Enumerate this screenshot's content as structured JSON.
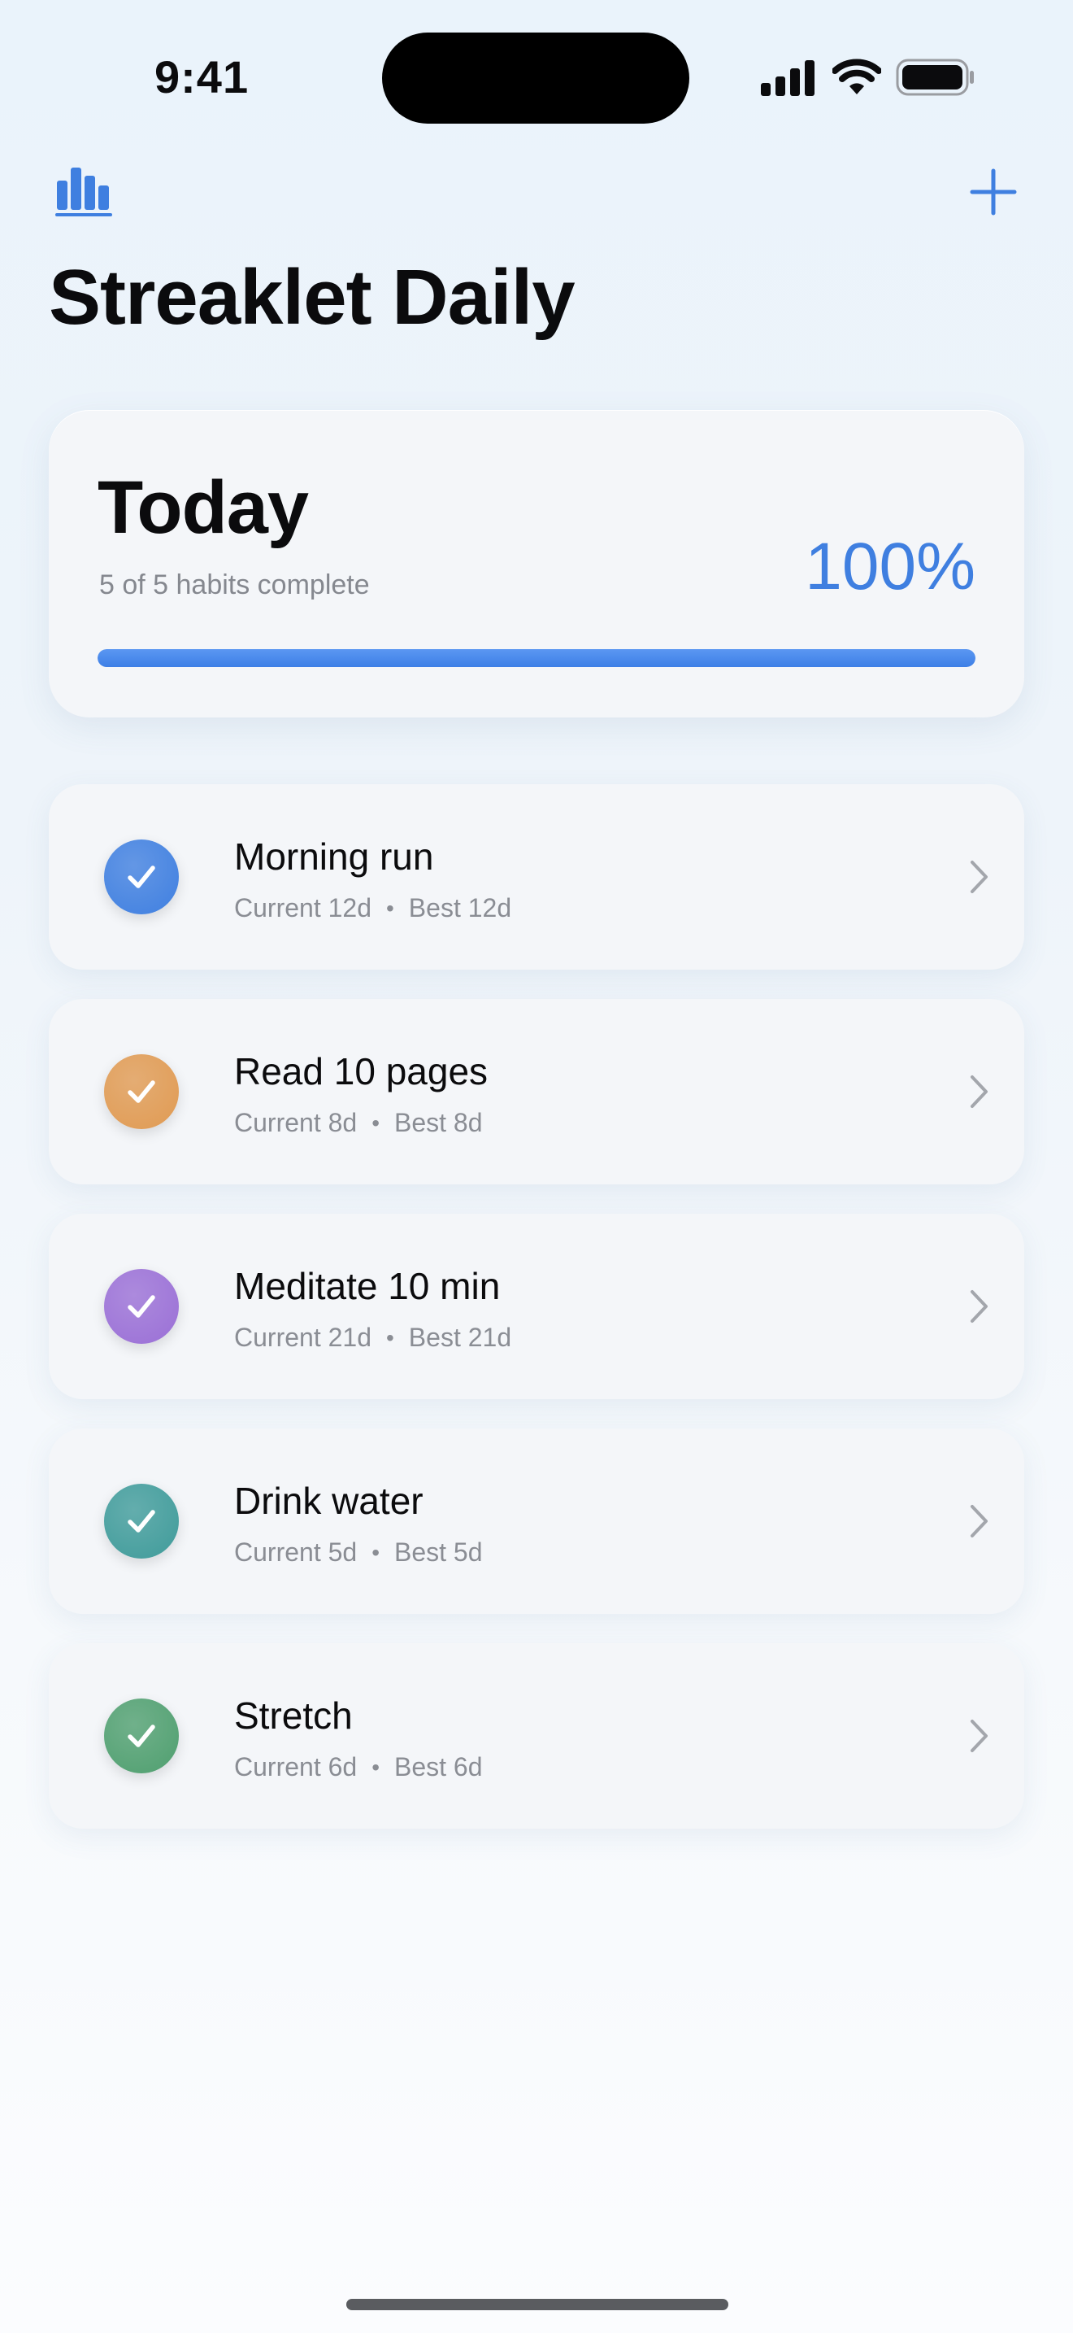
{
  "status_bar": {
    "time": "9:41"
  },
  "nav": {
    "stats_icon": "bar-chart-icon",
    "add_icon": "plus-icon",
    "accent": "#3f7fe0"
  },
  "app": {
    "title": "Streaklet Daily"
  },
  "summary": {
    "title": "Today",
    "subtitle": "5 of 5 habits complete",
    "percent_label": "100%",
    "progress": 1.0
  },
  "habits": [
    {
      "name": "Morning run",
      "current": "Current 12d",
      "best": "Best 12d",
      "color": "#3f7fe0",
      "done": true
    },
    {
      "name": "Read 10 pages",
      "current": "Current 8d",
      "best": "Best 8d",
      "color": "#e09a52",
      "done": true
    },
    {
      "name": "Meditate 10 min",
      "current": "Current 21d",
      "best": "Best 21d",
      "color": "#9a6fd6",
      "done": true
    },
    {
      "name": "Drink water",
      "current": "Current 5d",
      "best": "Best 5d",
      "color": "#3f9b9a",
      "done": true
    },
    {
      "name": "Stretch",
      "current": "Current 6d",
      "best": "Best 6d",
      "color": "#4f9f6f",
      "done": true
    }
  ],
  "separator": "•"
}
